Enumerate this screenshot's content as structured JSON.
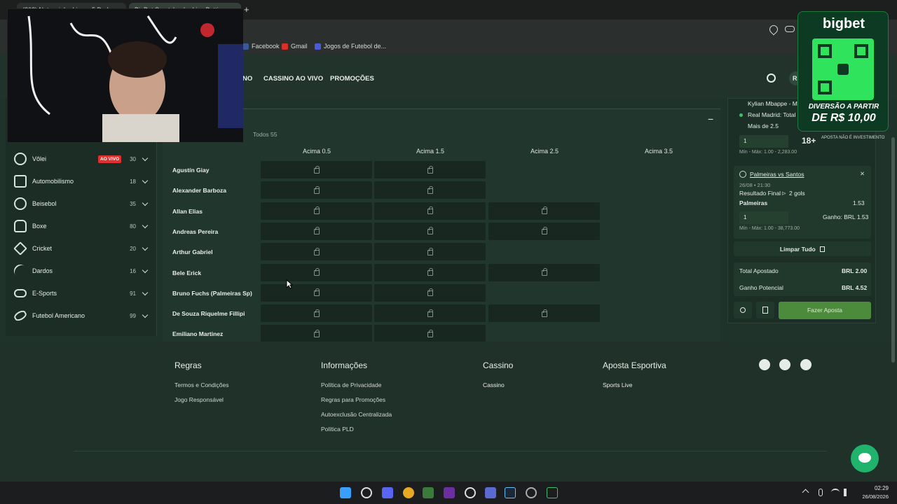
{
  "browser": {
    "tabs": [
      {
        "label": "(262) Natanzinho Lima - 5 Da I..."
      },
      {
        "label": "BigBet Sportsbook - Live Betti..."
      }
    ],
    "new_tab_symbol": "+"
  },
  "bookmarks": [
    {
      "label": "Facebook",
      "icon": "facebook-icon"
    },
    {
      "label": "Gmail",
      "icon": "gmail-icon"
    },
    {
      "label": "Jogos de Futebol de...",
      "icon": "bookmark-icon"
    }
  ],
  "site_nav": {
    "items": [
      {
        "label": "NO"
      },
      {
        "label": "CASSINO AO VIVO"
      },
      {
        "label": "PROMOÇÕES"
      }
    ],
    "balance_fragment": "R"
  },
  "sidebar": {
    "sports": [
      {
        "name": "Vôlei",
        "count": "30",
        "badge": "AO VIVO"
      },
      {
        "name": "Automobilismo",
        "count": "18"
      },
      {
        "name": "Beisebol",
        "count": "35"
      },
      {
        "name": "Boxe",
        "count": "80"
      },
      {
        "name": "Cricket",
        "count": "20"
      },
      {
        "name": "Dardos",
        "count": "16"
      },
      {
        "name": "E-Sports",
        "count": "91"
      },
      {
        "name": "Futebol Americano",
        "count": "99"
      }
    ]
  },
  "market": {
    "filter_label": "Todos 55",
    "collapse_symbol": "−",
    "columns": [
      "Acima 0.5",
      "Acima 1.5",
      "Acima 2.5",
      "Acima 3.5"
    ],
    "players": [
      {
        "name": "Agustín Giay",
        "available": [
          true,
          true,
          false,
          false
        ]
      },
      {
        "name": "Alexander Barboza",
        "available": [
          true,
          true,
          false,
          false
        ]
      },
      {
        "name": "Allan Elias",
        "available": [
          true,
          true,
          true,
          false
        ]
      },
      {
        "name": "Andreas Pereira",
        "available": [
          true,
          true,
          true,
          false
        ]
      },
      {
        "name": "Arthur Gabriel",
        "available": [
          true,
          true,
          false,
          false
        ]
      },
      {
        "name": "Bele Erick",
        "available": [
          true,
          true,
          true,
          false
        ]
      },
      {
        "name": "Bruno Fuchs (Palmeiras Sp)",
        "available": [
          true,
          true,
          false,
          false
        ]
      },
      {
        "name": "De Souza Riquelme Fillipi",
        "available": [
          true,
          true,
          true,
          false
        ]
      },
      {
        "name": "Emiliano Martinez",
        "available": [
          true,
          true,
          false,
          false
        ]
      }
    ]
  },
  "betslip": {
    "bet1": {
      "player": "Kylian Mbappe - Ma",
      "match": "Real Madrid: Total d",
      "selection": "Mais de 2.5",
      "stake": "1",
      "limits": "Mín - Máx: 1.00 - 2,283.00"
    },
    "bet2": {
      "title": "Palmeiras vs Santos",
      "datetime": "26/08 • 21:30",
      "market": "Resultado Final",
      "combo": "2 gols",
      "selection": "Palmeiras",
      "odds": "1.53",
      "stake": "1",
      "gain": "Ganho: BRL 1.53",
      "limits": "Mín - Máx: 1.00 - 38,773.00",
      "close_symbol": "✕"
    },
    "clear_label": "Limpar Tudo",
    "total_label": "Total Apostado",
    "total_value": "BRL 2.00",
    "potential_label": "Ganho Potencial",
    "potential_value": "BRL 4.52",
    "submit_label": "Fazer Aposta"
  },
  "footer": {
    "columns": [
      {
        "title": "Regras",
        "links": [
          "Termos e Condições",
          "Jogo Responsável"
        ]
      },
      {
        "title": "Informações",
        "links": [
          "Política de Privacidade",
          "Regras para Promoções",
          "Autoexclusão Centralizada",
          "Política PLD"
        ]
      },
      {
        "title": "Cassino",
        "links": [
          "Cassino"
        ]
      },
      {
        "title": "Aposta Esportiva",
        "links": [
          "Sports Live"
        ]
      }
    ]
  },
  "overlay": {
    "brand": "bigbet",
    "promo_line1": "DIVERSÃO A PARTIR",
    "promo_line2": "DE R$ 10,00",
    "age": "18+",
    "disclaimer": "APOSTA NÃO É INVESTIMENTO"
  },
  "taskbar": {
    "time": "02:29",
    "date": "26/08/2026"
  },
  "colors": {
    "accent_green": "#4c8a3c",
    "live_red": "#e03131",
    "page_bg": "#20332a"
  }
}
